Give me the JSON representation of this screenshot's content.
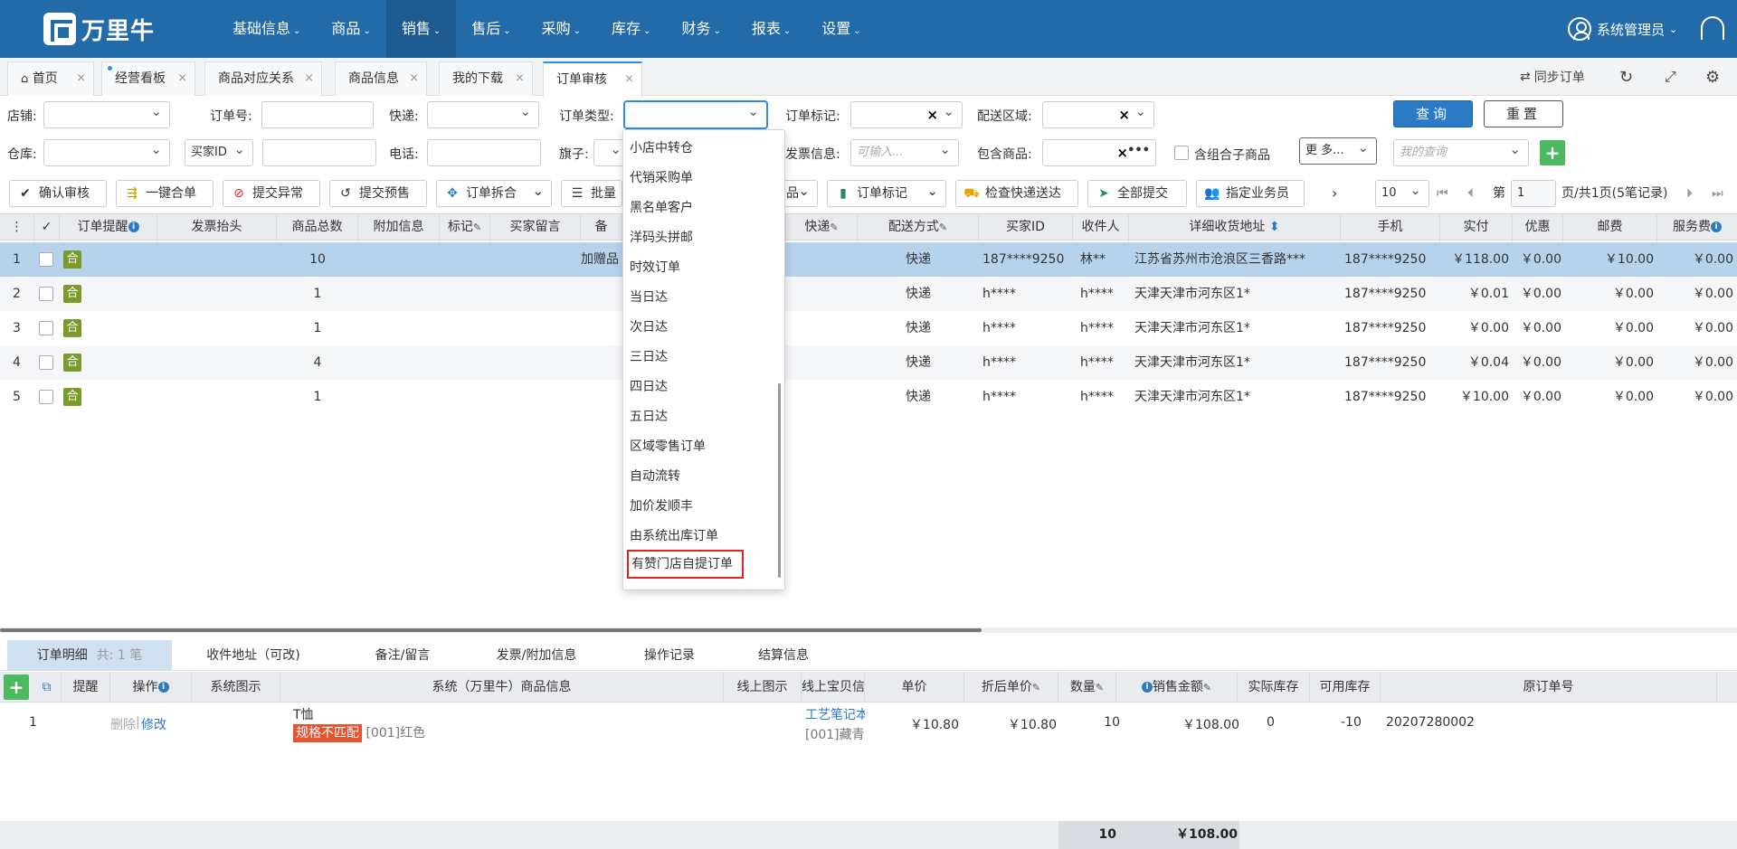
{
  "app": {
    "logo_text": "万里牛",
    "user": "系统管理员"
  },
  "nav": [
    {
      "label": "基础信息",
      "active": false
    },
    {
      "label": "商品",
      "active": false
    },
    {
      "label": "销售",
      "active": true
    },
    {
      "label": "售后",
      "active": false
    },
    {
      "label": "采购",
      "active": false
    },
    {
      "label": "库存",
      "active": false
    },
    {
      "label": "财务",
      "active": false
    },
    {
      "label": "报表",
      "active": false
    },
    {
      "label": "设置",
      "active": false
    }
  ],
  "tabs": [
    {
      "label": "首页"
    },
    {
      "label": "经营看板"
    },
    {
      "label": "商品对应关系"
    },
    {
      "label": "商品信息"
    },
    {
      "label": "我的下载"
    },
    {
      "label": "订单审核"
    }
  ],
  "tab_tools": {
    "sync": "同步订单"
  },
  "filters": {
    "shop": "店铺:",
    "order_no": "订单号:",
    "express": "快递:",
    "order_type": "订单类型:",
    "order_mark": "订单标记:",
    "region": "配送区域:",
    "warehouse": "仓库:",
    "buyer_id_select": "买家ID",
    "phone": "电话:",
    "flag": "旗子:",
    "invoice": "发票信息:",
    "invoice_placeholder": "可输入...",
    "contains": "包含商品:",
    "combo_label": "含组合子商品",
    "more": "更 多...",
    "my_query_placeholder": "我的查询",
    "query_btn": "查询",
    "reset_btn": "重置"
  },
  "actions": {
    "confirm": "确认审核",
    "merge": "一键合单",
    "exception": "提交异常",
    "presale": "提交预售",
    "split": "订单拆合",
    "batch": "批量",
    "mark_suffix": "品",
    "order_mark": "订单标记",
    "check_express": "检查快递送达",
    "submit_all": "全部提交",
    "assign": "指定业务员"
  },
  "pager": {
    "page_size": "10",
    "page_prefix": "第",
    "page_no": "1",
    "page_suffix": "页/共1页(5笔记录)"
  },
  "grid": {
    "headers": [
      "订单提醒",
      "发票抬头",
      "商品总数",
      "附加信息",
      "标记",
      "买家留言",
      "备",
      "快递",
      "配送方式",
      "买家ID",
      "收件人",
      "详细收货地址",
      "手机",
      "实付",
      "优惠",
      "邮费",
      "服务费"
    ],
    "rows": [
      {
        "no": "1",
        "badge": "合",
        "count": "10",
        "remark": "加赠品",
        "ship": "快递",
        "buyer": "187****9250",
        "recv": "林**",
        "addr": "江苏省苏州市沧浪区三香路***",
        "mobile": "187****9250",
        "paid": "￥118.00",
        "disc": "￥0.00",
        "post": "￥10.00",
        "svc": "￥0.00"
      },
      {
        "no": "2",
        "badge": "合",
        "count": "1",
        "remark": "",
        "ship": "快递",
        "buyer": "h****",
        "recv": "h****",
        "addr": "天津天津市河东区1*",
        "mobile": "187****9250",
        "paid": "￥0.01",
        "disc": "￥0.00",
        "post": "￥0.00",
        "svc": "￥0.00"
      },
      {
        "no": "3",
        "badge": "合",
        "count": "1",
        "remark": "",
        "ship": "快递",
        "buyer": "h****",
        "recv": "h****",
        "addr": "天津天津市河东区1*",
        "mobile": "187****9250",
        "paid": "￥0.00",
        "disc": "￥0.00",
        "post": "￥0.00",
        "svc": "￥0.00"
      },
      {
        "no": "4",
        "badge": "合",
        "count": "4",
        "remark": "",
        "ship": "快递",
        "buyer": "h****",
        "recv": "h****",
        "addr": "天津天津市河东区1*",
        "mobile": "187****9250",
        "paid": "￥0.04",
        "disc": "￥0.00",
        "post": "￥0.00",
        "svc": "￥0.00"
      },
      {
        "no": "5",
        "badge": "合",
        "count": "1",
        "remark": "",
        "ship": "快递",
        "buyer": "h****",
        "recv": "h****",
        "addr": "天津天津市河东区1*",
        "mobile": "187****9250",
        "paid": "￥10.00",
        "disc": "￥0.00",
        "post": "￥0.00",
        "svc": "￥0.00"
      }
    ]
  },
  "order_type_options": [
    "小店中转仓",
    "代销采购单",
    "黑名单客户",
    "洋码头拼邮",
    "时效订单",
    "当日达",
    "次日达",
    "三日达",
    "四日达",
    "五日达",
    "区域零售订单",
    "自动流转",
    "加价发顺丰",
    "由系统出库订单",
    "有赞门店自提订单"
  ],
  "bottom_tabs": [
    {
      "label": "订单明细",
      "count": "共: 1 笔"
    },
    {
      "label": "收件地址（可改)"
    },
    {
      "label": "备注/留言"
    },
    {
      "label": "发票/附加信息"
    },
    {
      "label": "操作记录"
    },
    {
      "label": "结算信息"
    }
  ],
  "detail": {
    "headers": [
      "提醒",
      "操作",
      "系统图示",
      "系统（万里牛）商品信息",
      "线上图示",
      "线上宝贝信",
      "单价",
      "折后单价",
      "数量",
      "销售金额",
      "实际库存",
      "可用库存",
      "原订单号"
    ],
    "row": {
      "no": "1",
      "delete": "删除",
      "modify": "修改",
      "name": "T恤",
      "mismatch": "规格不匹配",
      "spec": "[001]红色",
      "online_name": "工艺笔记本",
      "online_spec": "[001]藏青",
      "price": "￥10.80",
      "disc_price": "￥10.80",
      "qty": "10",
      "amount": "￥108.00",
      "actual": "0",
      "available": "-10",
      "orig_no": "20207280002"
    },
    "total_qty": "10",
    "total_amount": "￥108.00"
  }
}
